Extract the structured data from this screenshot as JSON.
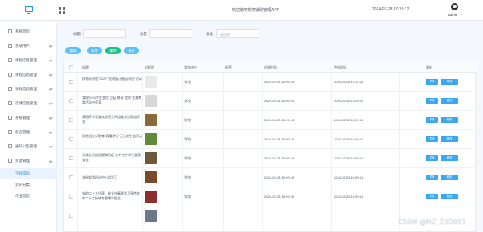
{
  "header": {
    "app_title": "欢迎使用校务辅助管理APP",
    "datetime": "2024-02-28 10:18:12",
    "username": "admin"
  },
  "sidebar": {
    "items": [
      {
        "label": "系统首页",
        "icon": "home-icon"
      },
      {
        "label": "系统用户",
        "icon": "user-icon"
      },
      {
        "label": "课程信息管理",
        "icon": "book-icon"
      },
      {
        "label": "课程信息管理",
        "icon": "book-icon"
      },
      {
        "label": "课程信息管理",
        "icon": "book-icon"
      },
      {
        "label": "选课信息管理",
        "icon": "list-icon"
      },
      {
        "label": "系统管理",
        "icon": "gear-icon"
      },
      {
        "label": "留言管理",
        "icon": "message-icon"
      },
      {
        "label": "通知公告管理",
        "icon": "notice-icon"
      },
      {
        "label": "资源管理",
        "icon": "folder-icon"
      }
    ],
    "sub_items": [
      {
        "label": "学校资讯",
        "active": true
      },
      {
        "label": "资讯分类",
        "active": false
      },
      {
        "label": "作业信息",
        "active": false
      }
    ]
  },
  "filters": {
    "title_label": "标题",
    "tag_label": "标签",
    "category_label": "分类",
    "category_placeholder": "请选择"
  },
  "actions": {
    "search": "查询",
    "add": "新增",
    "delete": "删除",
    "stats": "统计"
  },
  "table": {
    "headers": {
      "title": "标题",
      "cover": "封面图",
      "unit": "发布单位",
      "tag": "标签",
      "created": "创建时间",
      "updated": "更新时间",
      "ops": "操作"
    },
    "op_labels": {
      "detail": "详情",
      "edit": "修改"
    },
    "rows": [
      {
        "title": "校领导参加\"2022\"\"全校展示植培训班\"活动",
        "unit": "学校",
        "tag": "",
        "created": "2024-02-28 10:09:15",
        "updated": "2024-02-28 10:12:31",
        "thumb_color": "#e9e9e9"
      },
      {
        "title": "我校2023学生会在\"立足·修身·提质\"主题教育活动中获奖",
        "unit": "学校",
        "tag": "",
        "created": "2024-02-28 10:09:15",
        "updated": "2024-02-28 10:09:15",
        "thumb_color": "#d7d7d7"
      },
      {
        "title": "满园开学季喜欢求招生四组美食活动组织文",
        "unit": "学校",
        "tag": "",
        "created": "2024-02-28 10:09:15",
        "updated": "2024-02-28 10:09:15",
        "thumb_color": "#8a6a3a"
      },
      {
        "title": "宿舍园全义影育\"春播耕行\"元旦新生组活动",
        "unit": "学校",
        "tag": "",
        "created": "2024-02-28 10:09:15",
        "updated": "2024-02-28 10:09:15",
        "thumb_color": "#5f8a3c"
      },
      {
        "title": "扎紧五月组园提携防疫 全力守护学生健康安全",
        "unit": "学校",
        "tag": "",
        "created": "2024-02-28 10:09:15",
        "updated": "2024-02-28 10:09:15",
        "thumb_color": "#6e5a3a"
      },
      {
        "title": "学校党委理论中心组学习",
        "unit": "学校",
        "tag": "",
        "created": "2024-02-28 10:09:15",
        "updated": "2024-02-28 10:09:15",
        "thumb_color": "#7a4a2a"
      },
      {
        "title": "党的二十大代表、校长在春季学习宣传党的二十大精神专题辅导报告",
        "unit": "学校",
        "tag": "",
        "created": "2024-02-28 10:09:15",
        "updated": "2024-02-28 10:09:15",
        "thumb_color": "#8a2e2e"
      },
      {
        "title": "",
        "unit": "",
        "tag": "",
        "created": "",
        "updated": "",
        "thumb_color": "#6a7a8a"
      }
    ]
  },
  "watermark": "CSDN @MZ_ZXD001"
}
